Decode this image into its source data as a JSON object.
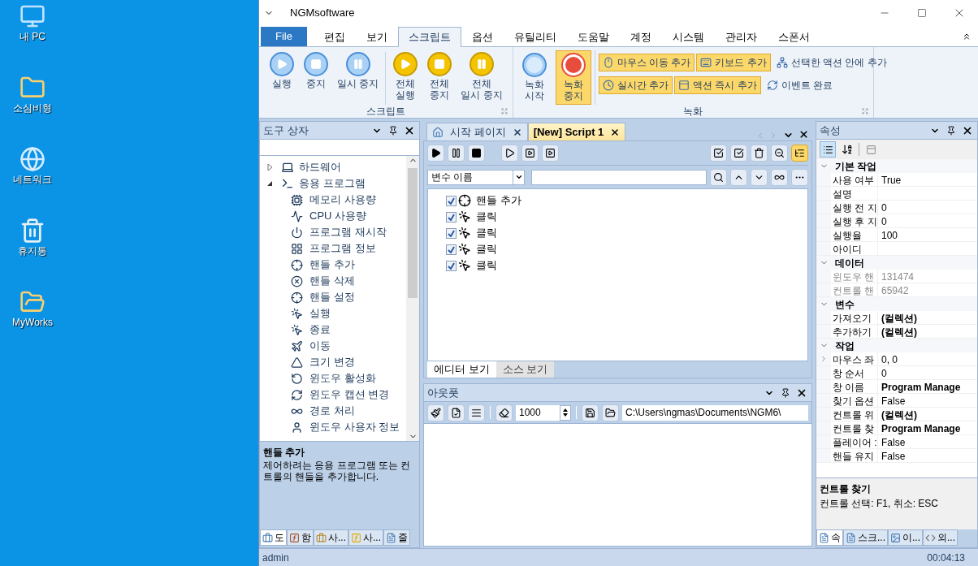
{
  "desktop_icons": [
    {
      "label": "내 PC"
    },
    {
      "label": "소심비형"
    },
    {
      "label": "네트워크"
    },
    {
      "label": "휴지통"
    },
    {
      "label": "MyWorks"
    }
  ],
  "window": {
    "title": "NGMsoftware"
  },
  "menu_tabs": [
    {
      "label": "File",
      "kind": "file",
      "selected": false
    },
    {
      "label": "편집",
      "kind": "tab",
      "selected": false
    },
    {
      "label": "보기",
      "kind": "tab",
      "selected": false
    },
    {
      "label": "스크립트",
      "kind": "tab",
      "selected": true
    },
    {
      "label": "옵션",
      "kind": "tab",
      "selected": false
    },
    {
      "label": "유틸리티",
      "kind": "tab",
      "selected": false
    },
    {
      "label": "도움말",
      "kind": "tab",
      "selected": false
    },
    {
      "label": "계정",
      "kind": "tab",
      "selected": false
    },
    {
      "label": "시스템",
      "kind": "tab",
      "selected": false
    },
    {
      "label": "관리자",
      "kind": "tab",
      "selected": false
    },
    {
      "label": "스폰서",
      "kind": "tab",
      "selected": false
    }
  ],
  "ribbon": {
    "script_group": {
      "title": "스크립트",
      "sets": [
        [
          {
            "lines": [
              "실행"
            ],
            "kind": "play"
          },
          {
            "lines": [
              "중지"
            ],
            "kind": "stop"
          },
          {
            "lines": [
              "일시 중지"
            ],
            "kind": "pause"
          }
        ],
        [
          {
            "lines": [
              "전체",
              "실행"
            ],
            "kind": "play-all"
          },
          {
            "lines": [
              "전체",
              "중지"
            ],
            "kind": "stop-all"
          },
          {
            "lines": [
              "전체",
              "일시 중지"
            ],
            "kind": "pause-all"
          }
        ]
      ]
    },
    "record_group": {
      "title": "녹화",
      "big_buttons": [
        {
          "lines": [
            "녹화",
            "시작"
          ],
          "kind": "record",
          "highlighted": false
        },
        {
          "lines": [
            "녹화",
            "중지"
          ],
          "kind": "record-stop",
          "highlighted": true
        }
      ],
      "small_rows": [
        [
          {
            "label": "마우스 이동 추가",
            "highlighted": true
          },
          {
            "label": "키보드 추가",
            "highlighted": true
          },
          {
            "label": "선택한 액션 안에 추가",
            "highlighted": false
          }
        ],
        [
          {
            "label": "실시간 추가",
            "highlighted": true
          },
          {
            "label": "액션 즉시 추가",
            "highlighted": true
          },
          {
            "label": "이벤트 완료",
            "highlighted": false
          }
        ]
      ]
    }
  },
  "toolbox": {
    "title": "도구 상자",
    "tree": [
      {
        "label": "하드웨어",
        "expanded": false
      },
      {
        "label": "응용 프로그램",
        "expanded": true,
        "children": [
          {
            "label": "메모리 사용량"
          },
          {
            "label": "CPU 사용량"
          },
          {
            "label": "프로그램 재시작"
          },
          {
            "label": "프로그램 정보"
          },
          {
            "label": "핸들 추가"
          },
          {
            "label": "핸들 삭제"
          },
          {
            "label": "핸들 설정"
          },
          {
            "label": "실행"
          },
          {
            "label": "종료"
          },
          {
            "label": "이동"
          },
          {
            "label": "크기 변경"
          },
          {
            "label": "윈도우 활성화"
          },
          {
            "label": "윈도우 캡션 변경"
          },
          {
            "label": "경로 처리"
          },
          {
            "label": "윈도우 사용자 정보"
          }
        ]
      }
    ],
    "description": {
      "title": "핸들 추가",
      "text": "제어하려는 응용 프로그램 또는 컨트롤의 핸들을 추가합니다."
    },
    "tabs": [
      {
        "label": "도",
        "selected": true
      },
      {
        "label": "함",
        "selected": false
      },
      {
        "label": "사...",
        "selected": false
      },
      {
        "label": "사...",
        "selected": false
      },
      {
        "label": "줄",
        "selected": false
      }
    ]
  },
  "documents": {
    "tabs": [
      {
        "label": "시작 페이지",
        "selected": false
      },
      {
        "label": "[New] Script 1",
        "selected": true
      }
    ],
    "variable_select": {
      "value": "변수 이름"
    },
    "actions": [
      {
        "label": "핸들 추가",
        "kind": "handle",
        "checked": true
      },
      {
        "label": "클릭",
        "kind": "click",
        "checked": true
      },
      {
        "label": "클릭",
        "kind": "click",
        "checked": true
      },
      {
        "label": "클릭",
        "kind": "click",
        "checked": true
      },
      {
        "label": "클릭",
        "kind": "click",
        "checked": true
      }
    ],
    "view_tabs": [
      {
        "label": "에디터 보기",
        "selected": true
      },
      {
        "label": "소스 보기",
        "selected": false
      }
    ]
  },
  "output": {
    "title": "아웃풋",
    "count": "1000",
    "path": "C:\\Users\\ngmas\\Documents\\NGM6\\"
  },
  "properties": {
    "title": "속성",
    "categories": [
      {
        "title": "기본 작업",
        "rows": [
          {
            "name": "사용 여부",
            "value": "True",
            "bold": false,
            "disabled": false,
            "expandable": false
          },
          {
            "name": "설명",
            "disabled": false,
            "expandable": false
          },
          {
            "name": "실행 전 지",
            "value": "0",
            "bold": false,
            "disabled": false,
            "expandable": false
          },
          {
            "name": "실행 후 지",
            "value": "0",
            "bold": false,
            "disabled": false,
            "expandable": false
          },
          {
            "name": "실행율",
            "value": "100",
            "bold": false,
            "disabled": false,
            "expandable": false
          },
          {
            "name": "아이디",
            "disabled": false,
            "expandable": false
          }
        ]
      },
      {
        "title": "데이터",
        "rows": [
          {
            "name": "윈도우 핸",
            "value": "131474",
            "bold": false,
            "disabled": true,
            "expandable": false
          },
          {
            "name": "컨트롤 핸",
            "value": "65942",
            "bold": false,
            "disabled": true,
            "expandable": false
          }
        ]
      },
      {
        "title": "변수",
        "rows": [
          {
            "name": "가져오기",
            "value": "(컬렉션)",
            "bold": true,
            "disabled": false,
            "expandable": false
          },
          {
            "name": "추가하기",
            "value": "(컬렉션)",
            "bold": true,
            "disabled": false,
            "expandable": false
          }
        ]
      },
      {
        "title": "작업",
        "rows": [
          {
            "name": "마우스 좌",
            "value": "0, 0",
            "bold": false,
            "disabled": false,
            "expandable": true
          },
          {
            "name": "창 순서",
            "value": "0",
            "bold": false,
            "disabled": false,
            "expandable": false
          },
          {
            "name": "창 이름",
            "value": "Program Manage",
            "bold": true,
            "disabled": false,
            "expandable": false
          },
          {
            "name": "찾기 옵션",
            "value": "False",
            "bold": false,
            "disabled": false,
            "expandable": false
          },
          {
            "name": "컨트롤 위",
            "value": "(컬렉션)",
            "bold": true,
            "disabled": false,
            "expandable": false
          },
          {
            "name": "컨트롤 찾",
            "value": "Program Manage",
            "bold": true,
            "disabled": false,
            "expandable": false
          },
          {
            "name": "플레이어 :",
            "value": "False",
            "bold": false,
            "disabled": false,
            "expandable": false
          },
          {
            "name": "핸들 유지",
            "value": "False",
            "bold": false,
            "disabled": false,
            "expandable": false
          }
        ]
      }
    ],
    "description": {
      "title": "컨트롤 찾기",
      "text": "컨트롤 선택: F1, 취소: ESC"
    },
    "tabs": [
      {
        "label": "속",
        "selected": true
      },
      {
        "label": "스크...",
        "selected": false
      },
      {
        "label": "이...",
        "selected": false
      },
      {
        "label": "외...",
        "selected": false
      }
    ]
  },
  "status_bar": {
    "user": "admin",
    "time": "00:04:13"
  }
}
